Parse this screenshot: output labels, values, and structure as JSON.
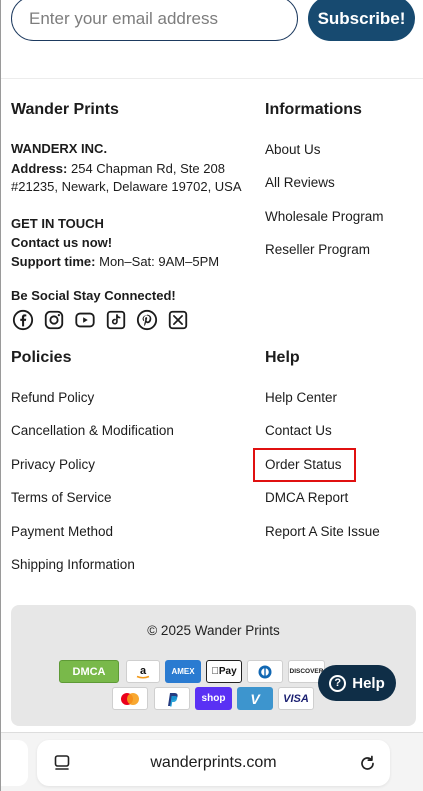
{
  "newsletter": {
    "email_placeholder": "Enter your email address",
    "subscribe_label": "Subscribe!"
  },
  "brand": {
    "heading": "Wander Prints",
    "company": "WANDERX INC.",
    "address_label": "Address:",
    "address_line1": "254 Chapman Rd, Ste 208",
    "address_line2": "#21235, Newark, Delaware 19702, USA",
    "get_in_touch": "GET IN TOUCH",
    "contact_now": "Contact us now!",
    "support_label": "Support time:",
    "support_value": "Mon–Sat: 9AM–5PM",
    "social_heading": "Be Social Stay Connected!",
    "social_icons": [
      "facebook-icon",
      "instagram-icon",
      "youtube-icon",
      "tiktok-icon",
      "pinterest-icon",
      "x-icon"
    ]
  },
  "informations": {
    "heading": "Informations",
    "links": [
      "About Us",
      "All Reviews",
      "Wholesale Program",
      "Reseller Program"
    ]
  },
  "policies": {
    "heading": "Policies",
    "links": [
      "Refund Policy",
      "Cancellation & Modification",
      "Privacy Policy",
      "Terms of Service",
      "Payment Method",
      "Shipping Information"
    ]
  },
  "help": {
    "heading": "Help",
    "links": [
      "Help Center",
      "Contact Us",
      "Order Status",
      "DMCA Report",
      "Report A Site Issue"
    ]
  },
  "footer": {
    "copyright": "© 2025 Wander Prints",
    "dmca_badge": "DMCA",
    "payment_row1": [
      "amazon-pay-icon",
      "american-express-icon",
      "apple-pay-icon",
      "diners-club-icon",
      "discover-icon"
    ],
    "payment_row2": [
      "mastercard-icon",
      "paypal-icon",
      "shop-pay-icon",
      "venmo-icon",
      "visa-icon"
    ],
    "pay_labels": {
      "amex": "AMEX",
      "apple_pay": "Pay",
      "discover": "DISCOVER",
      "shop_pay": "shop",
      "venmo": "V",
      "visa": "VISA"
    }
  },
  "help_bubble": {
    "label": "Help"
  },
  "browser": {
    "url": "wanderprints.com"
  },
  "colors": {
    "primary": "#174a70",
    "help_bubble": "#0f2e47",
    "highlight": "#e01010",
    "card_bg": "#e7e7e7"
  }
}
